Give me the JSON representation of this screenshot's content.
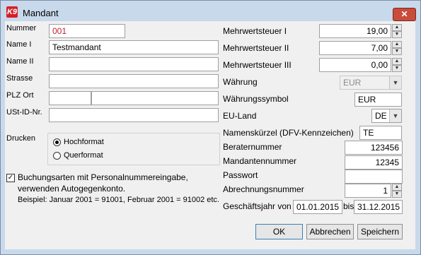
{
  "window": {
    "title": "Mandant",
    "logo": "K9",
    "close": "✕"
  },
  "left": {
    "nummer_label": "Nummer",
    "nummer_value": "001",
    "name1_label": "Name I",
    "name1_value": "Testmandant",
    "name2_label": "Name II",
    "name2_value": "",
    "strasse_label": "Strasse",
    "strasse_value": "",
    "plzort_label": "PLZ Ort",
    "plz_value": "",
    "ort_value": "",
    "ustid_label": "USt-ID-Nr.",
    "ustid_value": "",
    "drucken_label": "Drucken",
    "radio_hochformat": "Hochformat",
    "radio_querformat": "Querformat",
    "checkbox_text1": "Buchungsarten mit Personalnummereingabe,",
    "checkbox_text2": "verwenden Autogegenkonto.",
    "beispiel": "Beispiel: Januar 2001 = 91001, Februar 2001 = 91002 etc."
  },
  "right": {
    "mwst1_label": "Mehrwertsteuer I",
    "mwst1_value": "19,00",
    "mwst2_label": "Mehrwertsteuer II",
    "mwst2_value": "7,00",
    "mwst3_label": "Mehrwertsteuer III",
    "mwst3_value": "0,00",
    "waehrung_label": "Währung",
    "waehrung_value": "EUR",
    "symbol_label": "Währungssymbol",
    "symbol_value": "EUR",
    "euland_label": "EU-Land",
    "euland_value": "DE",
    "kuerzel_label": "Namenskürzel (DFV-Kennzeichen)",
    "kuerzel_value": "TE",
    "berater_label": "Beraternummer",
    "berater_value": "123456",
    "mandanten_label": "Mandantennummer",
    "mandanten_value": "12345",
    "passwort_label": "Passwort",
    "passwort_value": "",
    "abrechnung_label": "Abrechnungsnummer",
    "abrechnung_value": "1",
    "gj_label": "Geschäftsjahr von",
    "gj_from": "01.01.2015",
    "gj_bis": "bis",
    "gj_to": "31.12.2015"
  },
  "buttons": {
    "ok": "OK",
    "abbrechen": "Abbrechen",
    "speichern": "Speichern"
  },
  "colors": {
    "nummer_text": "#c0202a"
  }
}
